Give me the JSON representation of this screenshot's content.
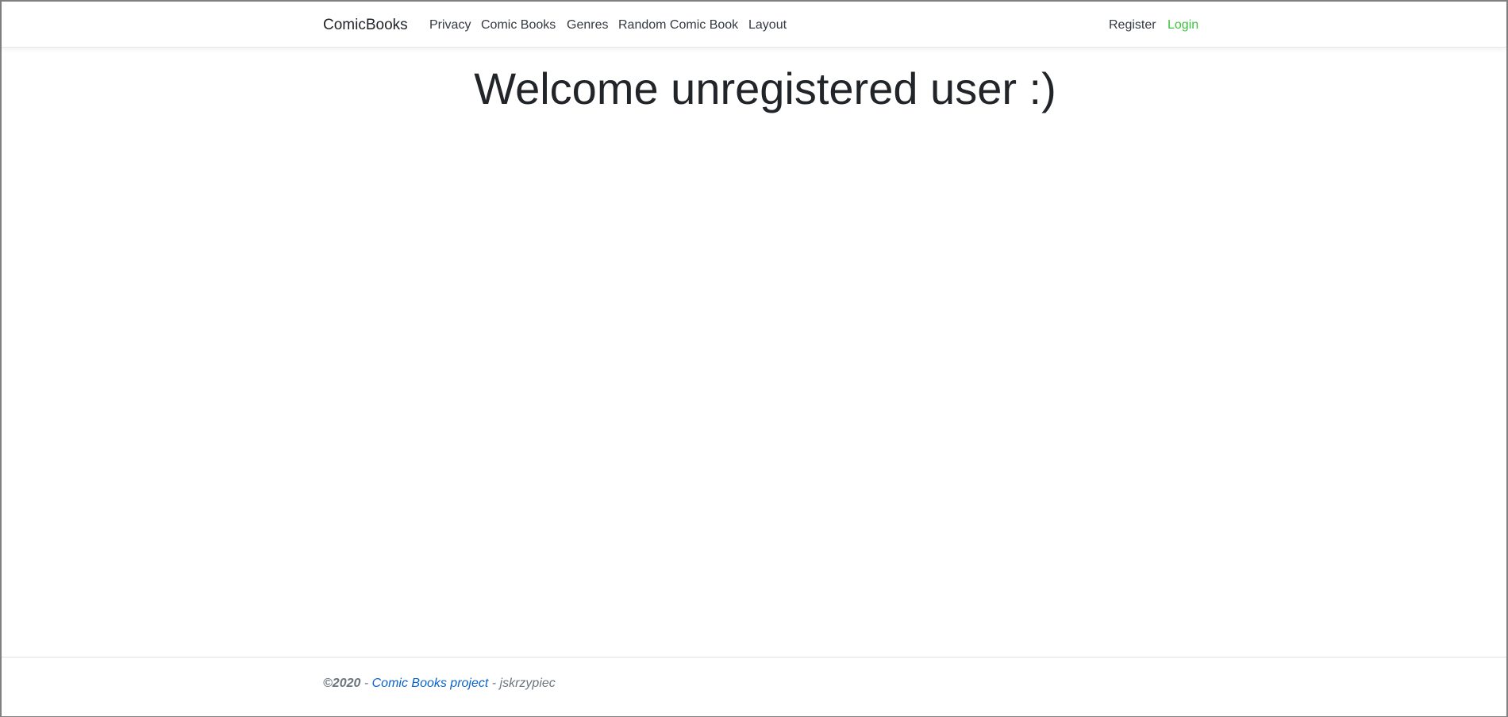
{
  "navbar": {
    "brand": "ComicBooks",
    "links": [
      "Privacy",
      "Comic Books",
      "Genres",
      "Random Comic Book",
      "Layout"
    ],
    "register": "Register",
    "login": "Login"
  },
  "main": {
    "heading": "Welcome unregistered user :)"
  },
  "footer": {
    "copyright": "©2020",
    "sep1": " - ",
    "project_link": "Comic Books project",
    "sep2": " - ",
    "author": "jskrzypiec"
  },
  "colors": {
    "login_green": "#3cc23c",
    "link_blue": "#0b63c9"
  }
}
